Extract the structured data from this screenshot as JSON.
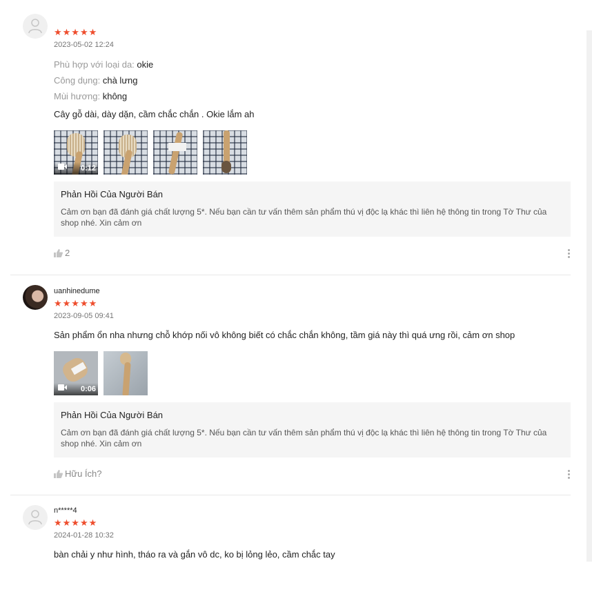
{
  "reviews": [
    {
      "stars": "★★★★★",
      "date": "2023-05-02 12:24",
      "attributes": [
        {
          "key": "Phù hợp với loại da:",
          "value": "okie"
        },
        {
          "key": "Công dụng:",
          "value": "chà lưng"
        },
        {
          "key": "Mùi hương:",
          "value": "không"
        }
      ],
      "comment": "Cây gỗ dài, dày dặn, cầm chắc chắn . Okie lắm ah",
      "video_duration": "0:12",
      "reply_title": "Phản Hồi Của Người Bán",
      "reply_text": "Cảm ơn bạn đã đánh giá chất lượng 5*. Nếu bạn cần tư vấn thêm sản phẩm thú vị độc lạ khác thì liên hệ thông tin trong Tờ Thư của shop nhé. Xin cảm ơn",
      "likes": "2"
    },
    {
      "username": "uanhinedume",
      "stars": "★★★★★",
      "date": "2023-09-05 09:41",
      "comment": "Sản phẩm ổn nha nhưng chỗ khớp nối vô không biết có chắc chắn không, tầm giá này thì quá ưng rồi, cảm ơn shop",
      "video_duration": "0:06",
      "reply_title": "Phản Hồi Của Người Bán",
      "reply_text": "Cảm ơn bạn đã đánh giá chất lượng 5*. Nếu bạn cần tư vấn thêm sản phẩm thú vị độc lạ khác thì liên hệ thông tin trong Tờ Thư của shop nhé. Xin cảm ơn",
      "likes": "Hữu Ích?"
    },
    {
      "username": "n*****4",
      "stars": "★★★★★",
      "date": "2024-01-28 10:32",
      "comment": "bàn chải y như hình, tháo ra và gắn vô dc, ko bị lỏng lẻo, cầm chắc tay"
    }
  ],
  "icons": {
    "thumb_up": "thumb-up-icon",
    "video": "video-camera-icon",
    "more": "more-vertical-icon",
    "default_avatar": "user-icon"
  },
  "colors": {
    "star": "#ee4d2d",
    "reply_bg": "#f5f5f5"
  }
}
